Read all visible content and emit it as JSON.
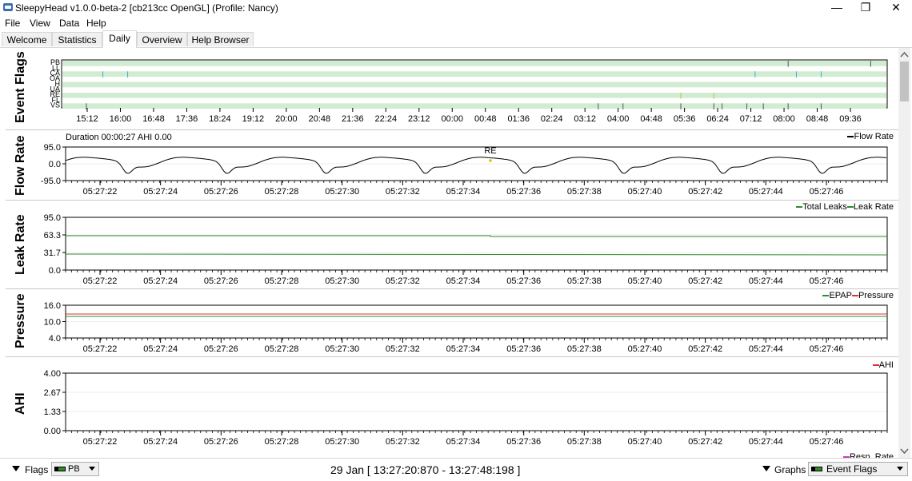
{
  "window": {
    "title": "SleepyHead v1.0.0-beta-2 [cb213cc OpenGL] (Profile: Nancy)",
    "minimize_glyph": "—",
    "restore_glyph": "❐",
    "close_glyph": "✕"
  },
  "menu": [
    "File",
    "View",
    "Data",
    "Help"
  ],
  "tabs": [
    "Welcome",
    "Statistics",
    "Daily",
    "Overview",
    "Help Browser"
  ],
  "active_tab": "Daily",
  "event_flags": {
    "title": "Event Flags",
    "rows": [
      "PB",
      "LL",
      "CA",
      "OA",
      "H",
      "UA",
      "RE",
      "FL",
      "VS"
    ],
    "time_ticks": [
      "15:12",
      "16:00",
      "16:48",
      "17:36",
      "18:24",
      "19:12",
      "20:00",
      "20:48",
      "21:36",
      "22:24",
      "23:12",
      "00:00",
      "00:48",
      "01:36",
      "02:24",
      "03:12",
      "04:00",
      "04:48",
      "05:36",
      "06:24",
      "07:12",
      "08:00",
      "08:48",
      "09:36"
    ],
    "band_color": "#d2ecd2"
  },
  "flow_rate": {
    "title": "Flow Rate",
    "header": "Duration 00:00:27 AHI 0.00",
    "legend": "Flow Rate",
    "y_ticks": [
      "95.0",
      "0.0",
      "-95.0"
    ],
    "annotation": "RE"
  },
  "leak_rate": {
    "title": "Leak Rate",
    "legend_1": "Total Leaks",
    "legend_2": "Leak Rate",
    "y_ticks": [
      "95.0",
      "63.3",
      "31.7",
      "0.0"
    ],
    "total_color": "#2e8b2e",
    "leak_color": "#2e8b2e"
  },
  "pressure": {
    "title": "Pressure",
    "legend_1": "EPAP",
    "legend_2": "Pressure",
    "y_ticks": [
      "16.0",
      "10.0",
      "4.0"
    ],
    "epap_color": "#2e8b2e",
    "pressure_color": "#e03030"
  },
  "ahi": {
    "title": "AHI",
    "legend": "AHI",
    "y_ticks": [
      "4.00",
      "2.67",
      "1.33",
      "0.00"
    ],
    "color": "#e03030"
  },
  "resp_rate_legend": "Resp. Rate",
  "x_ticks": [
    "05:27:22",
    "05:27:24",
    "05:27:26",
    "05:27:28",
    "05:27:30",
    "05:27:32",
    "05:27:34",
    "05:27:36",
    "05:27:38",
    "05:27:40",
    "05:27:42",
    "05:27:44",
    "05:27:46"
  ],
  "bottom": {
    "flags_label": "Flags",
    "flags_value": "PB",
    "range": "29 Jan [ 13:27:20:870 - 13:27:48:198 ]",
    "graphs_label": "Graphs",
    "graphs_value": "Event Flags"
  }
}
